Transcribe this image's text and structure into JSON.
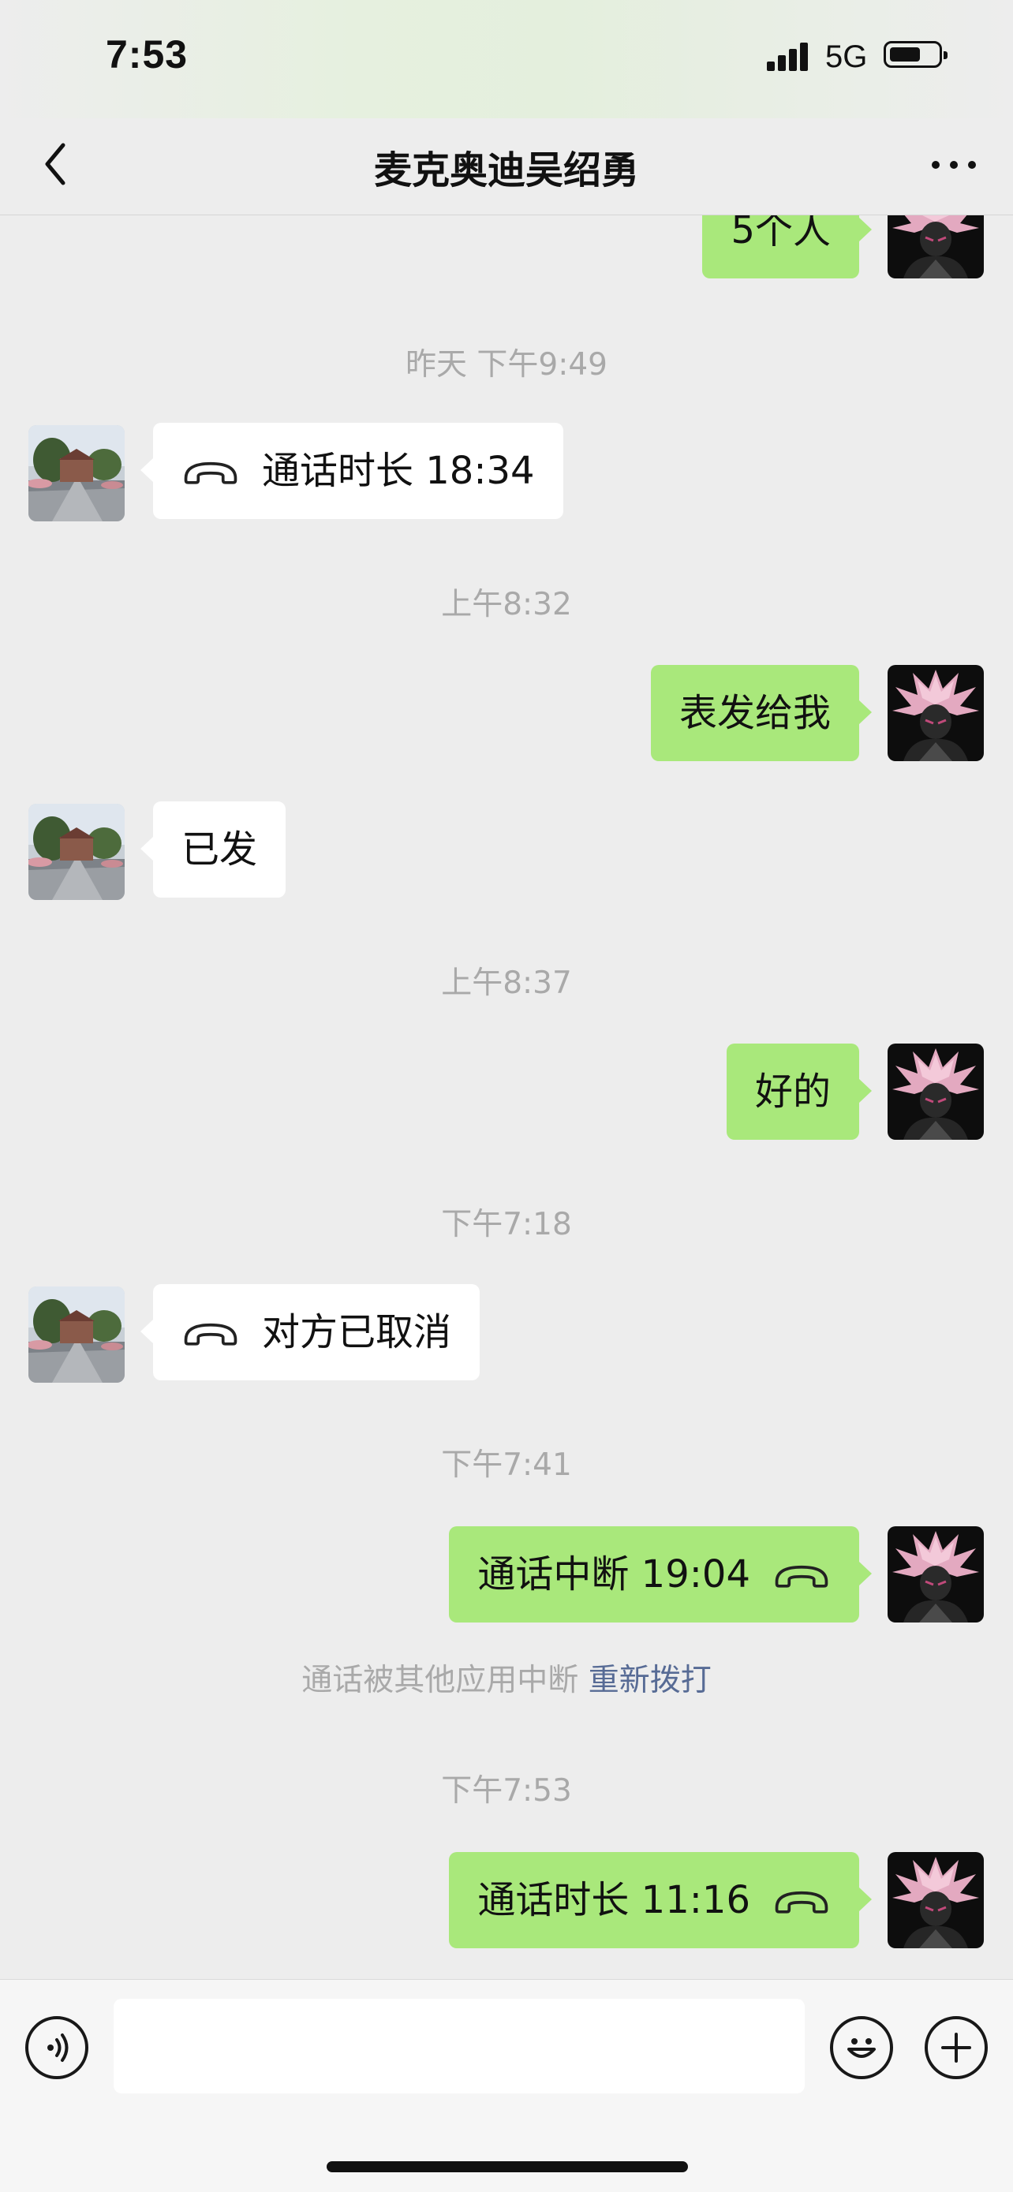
{
  "status_bar": {
    "time": "7:53",
    "network": "5G"
  },
  "header": {
    "title": "麦克奥迪吴绍勇"
  },
  "messages": {
    "m0": {
      "text": "5个人"
    },
    "ts1": "昨天 下午9:49",
    "m1": {
      "text": "通话时长 18:34"
    },
    "ts2": "上午8:32",
    "m2": {
      "text": "表发给我"
    },
    "m3": {
      "text": "已发"
    },
    "ts3": "上午8:37",
    "m4": {
      "text": "好的"
    },
    "ts4": "下午7:18",
    "m5": {
      "text": "对方已取消"
    },
    "ts5": "下午7:41",
    "m6": {
      "text": "通话中断 19:04"
    },
    "sys1": {
      "text": "通话被其他应用中断",
      "link": "重新拨打"
    },
    "ts6": "下午7:53",
    "m7": {
      "text": "通话时长 11:16"
    }
  },
  "input_bar": {
    "value": "",
    "placeholder": ""
  },
  "icons": {
    "call": "phone-hangup-icon",
    "voice": "voice-icon",
    "emoji": "emoji-icon",
    "more": "plus-icon"
  },
  "colors": {
    "outgoing_bubble": "#a9e87b",
    "incoming_bubble": "#ffffff",
    "background": "#ededed",
    "link": "#576b95",
    "timestamp": "#a9a9a9"
  }
}
